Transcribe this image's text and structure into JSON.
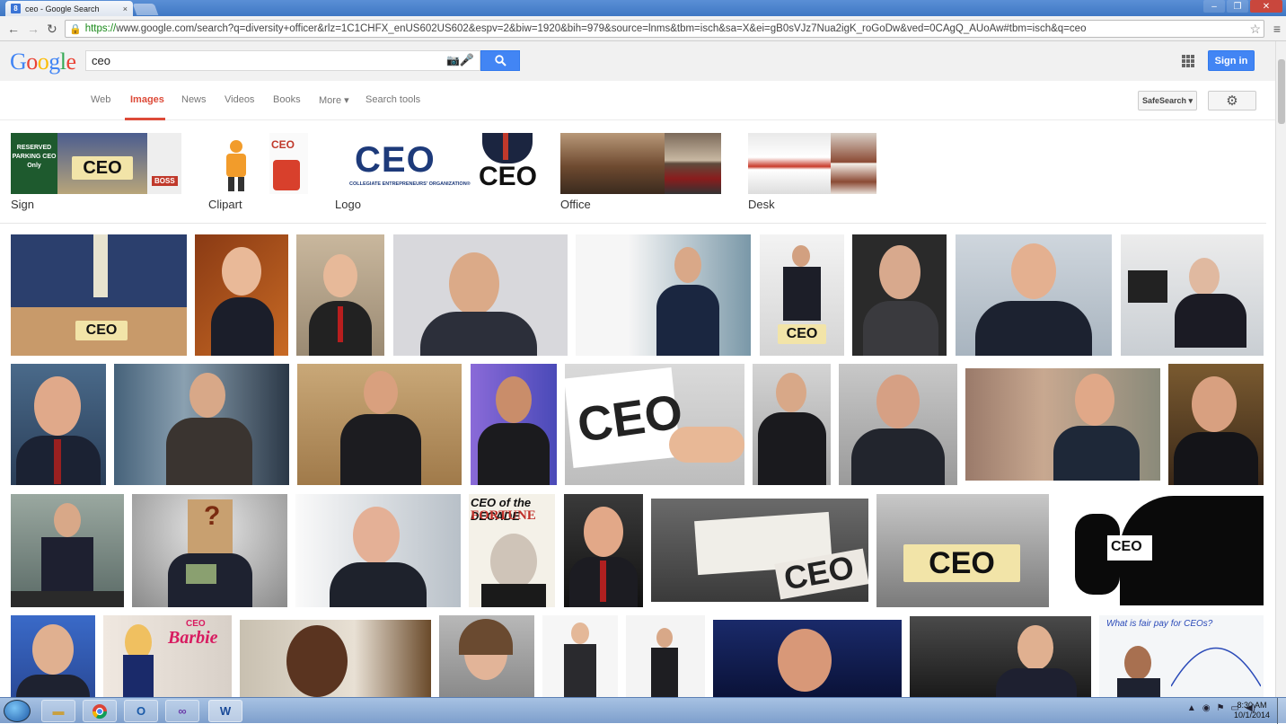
{
  "browser": {
    "tab_title": "ceo - Google Search",
    "tab_close": "×",
    "favicon": "8",
    "url_https": "https://",
    "url_rest": "www.google.com/search?q=diversity+officer&rlz=1C1CHFX_enUS602US602&espv=2&biw=1920&bih=979&source=lnms&tbm=isch&sa=X&ei=gB0sVJz7Nua2igK_roGoDw&ved=0CAgQ_AUoAw#tbm=isch&q=ceo",
    "icons": [
      "back-arrow-icon",
      "forward-arrow-icon",
      "reload-icon",
      "lock-icon",
      "bookmark-star-icon",
      "chrome-menu-icon"
    ]
  },
  "google": {
    "logo_letters": [
      {
        "ch": "G",
        "color": "#4285f4"
      },
      {
        "ch": "o",
        "color": "#ea4335"
      },
      {
        "ch": "o",
        "color": "#fbbc05"
      },
      {
        "ch": "g",
        "color": "#4285f4"
      },
      {
        "ch": "l",
        "color": "#34a853"
      },
      {
        "ch": "e",
        "color": "#ea4335"
      }
    ],
    "query": "ceo",
    "signin_label": "Sign in",
    "tabs": [
      "Web",
      "Images",
      "News",
      "Videos",
      "Books",
      "More ▾",
      "Search tools"
    ],
    "active_tab": "Images",
    "safesearch_label": "SafeSearch ▾"
  },
  "related": [
    {
      "label": "Sign",
      "text1": "RESERVED PARKING CEO Only",
      "text2": "CEO",
      "text3": "BOSS"
    },
    {
      "label": "Clipart",
      "text1": "CEO"
    },
    {
      "label": "Logo",
      "text1": "CEO",
      "text2": "COLLEGIATE ENTREPRENEURS' ORGANIZATION®"
    },
    {
      "label": "Office"
    },
    {
      "label": "Desk"
    }
  ],
  "image_text": {
    "ceo": "CEO",
    "fortune_top": "CEO of the DECADE",
    "fortune": "FORTUNE",
    "barbie_ceo": "CEO",
    "barbie": "Barbie",
    "question": "?",
    "whiteboard": "What is fair pay for CEOs?"
  },
  "taskbar": {
    "time": "8:30 AM",
    "date": "10/1/2014",
    "items": [
      "file-explorer-icon",
      "chrome-icon",
      "outlook-icon",
      "visual-studio-icon",
      "word-icon"
    ]
  },
  "colors": {
    "google_blue": "#4285f4",
    "active_tab_red": "#dd4b39"
  }
}
